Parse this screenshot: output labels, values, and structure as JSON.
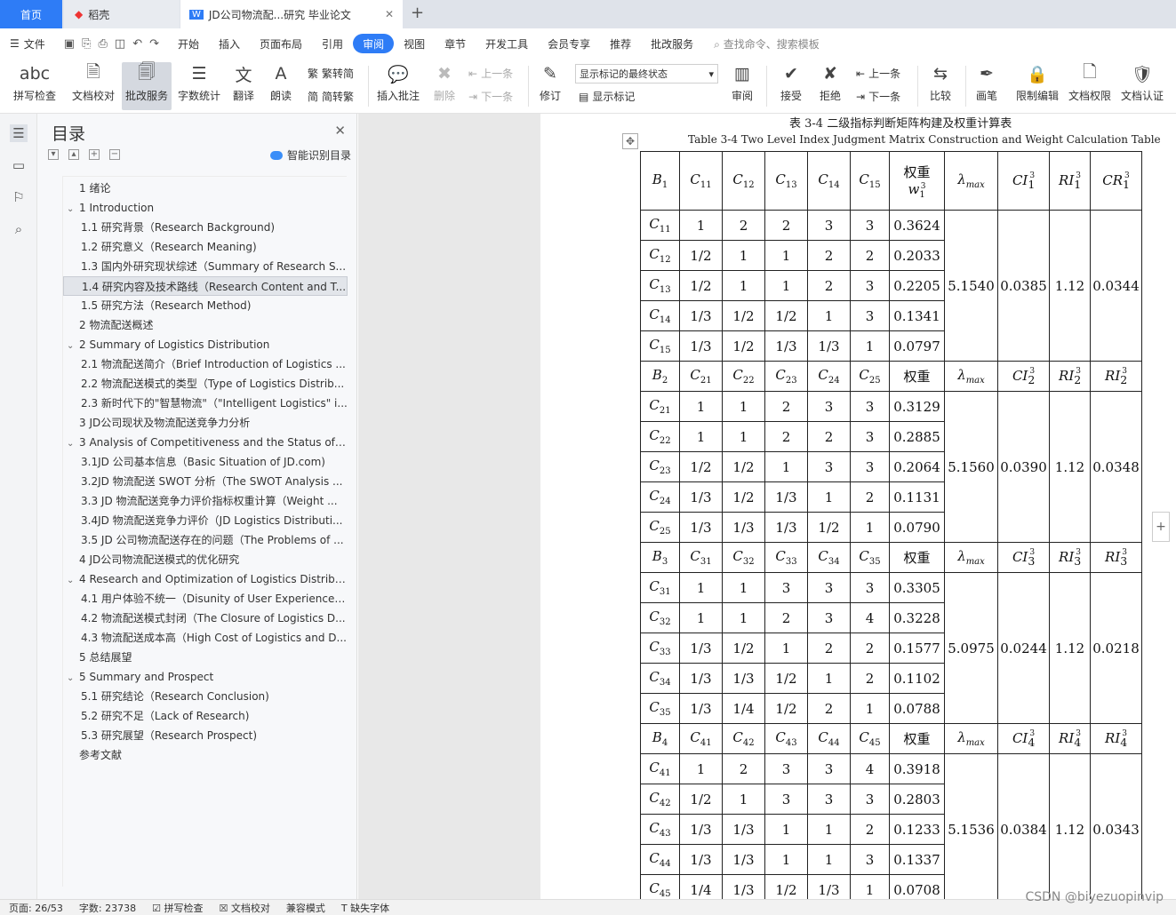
{
  "tabs": {
    "home": "首页",
    "daoke": "稻壳",
    "doc": "JD公司物流配...研究 毕业论文"
  },
  "menu": {
    "file": "文件",
    "items": [
      "开始",
      "插入",
      "页面布局",
      "引用",
      "审阅",
      "视图",
      "章节",
      "开发工具",
      "会员专享",
      "推荐",
      "批改服务"
    ],
    "active": "审阅",
    "search": "查找命令、搜索模板"
  },
  "ribbon": {
    "spell": "拼写检查",
    "proof": "文档校对",
    "grading": "批改服务",
    "wordcount": "字数统计",
    "translate": "翻译",
    "read": "朗读",
    "trad": "繁转简",
    "simp": "简转繁",
    "add_comment": "插入批注",
    "delete": "删除",
    "prev": "上一条",
    "next": "下一条",
    "track": "修订",
    "markup_state": "显示标记的最终状态",
    "show_markup": "显示标记",
    "review": "审阅",
    "accept": "接受",
    "reject": "拒绝",
    "prev2": "上一条",
    "next2": "下一条",
    "compare": "比较",
    "pen": "画笔",
    "restrict": "限制编辑",
    "perm": "文档权限",
    "cert": "文档认证"
  },
  "toc": {
    "title": "目录",
    "smart": "智能识别目录",
    "items": [
      {
        "level": 1,
        "text": "1  绪论",
        "chev": ""
      },
      {
        "level": 1,
        "text": "1 Introduction",
        "chev": "v"
      },
      {
        "level": 2,
        "text": "1.1  研究背景（Research Background)"
      },
      {
        "level": 2,
        "text": "1.2  研究意义（Research Meaning)"
      },
      {
        "level": 2,
        "text": "1.3  国内外研究现状综述（Summary of Research S..."
      },
      {
        "level": 2,
        "text": "1.4 研究内容及技术路线（Research Content and T...",
        "selected": true
      },
      {
        "level": 2,
        "text": "1.5 研究方法（Research Method)"
      },
      {
        "level": 1,
        "text": "2  物流配送概述",
        "chev": ""
      },
      {
        "level": 1,
        "text": "2 Summary of Logistics Distribution",
        "chev": "v"
      },
      {
        "level": 2,
        "text": "2.1 物流配送简介（Brief Introduction of Logistics ..."
      },
      {
        "level": 2,
        "text": "2.2 物流配送模式的类型（Type of Logistics Distrib..."
      },
      {
        "level": 2,
        "text": "2.3 新时代下的\"智慧物流\"（\"Intelligent Logistics\" i..."
      },
      {
        "level": 1,
        "text": "3 JD公司现状及物流配送竞争力分析",
        "chev": ""
      },
      {
        "level": 1,
        "text": "3 Analysis of Competitiveness and the Status of JD...",
        "chev": "v"
      },
      {
        "level": 2,
        "text": "3.1JD 公司基本信息（Basic Situation of JD.com)"
      },
      {
        "level": 2,
        "text": "3.2JD 物流配送 SWOT 分析（The SWOT Analysis ..."
      },
      {
        "level": 2,
        "text": "3.3 JD 物流配送竞争力评价指标权重计算（Weight ..."
      },
      {
        "level": 2,
        "text": "3.4JD 物流配送竞争力评价（JD Logistics Distributi..."
      },
      {
        "level": 2,
        "text": "3.5 JD 公司物流配送存在的问题（The Problems of ..."
      },
      {
        "level": 1,
        "text": "4 JD公司物流配送模式的优化研究",
        "chev": ""
      },
      {
        "level": 1,
        "text": "4 Research and Optimization of Logistics Distributi...",
        "chev": "v"
      },
      {
        "level": 2,
        "text": "4.1 用户体验不统一（Disunity of User Experience ..."
      },
      {
        "level": 2,
        "text": "4.2 物流配送模式封闭（The Closure of Logistics D..."
      },
      {
        "level": 2,
        "text": "4.3 物流配送成本高（High Cost of Logistics and D..."
      },
      {
        "level": 1,
        "text": "5  总结展望",
        "chev": ""
      },
      {
        "level": 1,
        "text": "5 Summary and Prospect",
        "chev": "v"
      },
      {
        "level": 2,
        "text": "5.1 研究结论（Research Conclusion)"
      },
      {
        "level": 2,
        "text": "5.2 研究不足（Lack of Research)"
      },
      {
        "level": 2,
        "text": "5.3 研究展望（Research Prospect)"
      },
      {
        "level": 0,
        "text": "参考文献",
        "chev": ""
      }
    ]
  },
  "document": {
    "caption_cn": "表  3-4  二级指标判断矩阵构建及权重计算表",
    "caption_en": "Table 3-4 Two Level Index Judgment Matrix Construction and Weight Calculation Table",
    "header0": [
      "B1",
      "C11",
      "C12",
      "C13",
      "C14",
      "C15",
      "权重 w13",
      "λmax",
      "CI13",
      "RI13",
      "CR13"
    ],
    "blocks": [
      {
        "header": null,
        "rows": [
          [
            "C11",
            "1",
            "2",
            "2",
            "3",
            "3",
            "0.3624"
          ],
          [
            "C12",
            "1/2",
            "1",
            "1",
            "2",
            "2",
            "0.2033"
          ],
          [
            "C13",
            "1/2",
            "1",
            "1",
            "2",
            "3",
            "0.2205"
          ],
          [
            "C14",
            "1/3",
            "1/2",
            "1/2",
            "1",
            "3",
            "0.1341"
          ],
          [
            "C15",
            "1/3",
            "1/2",
            "1/3",
            "1/3",
            "1",
            "0.0797"
          ]
        ],
        "lmax": "5.1540",
        "ci": "0.0385",
        "ri": "1.12",
        "cr": "0.0344"
      },
      {
        "header": [
          "B2",
          "C21",
          "C22",
          "C23",
          "C24",
          "C25",
          "权重",
          "λmax",
          "CI23",
          "RI23",
          "RI23"
        ],
        "rows": [
          [
            "C21",
            "1",
            "1",
            "2",
            "3",
            "3",
            "0.3129"
          ],
          [
            "C22",
            "1",
            "1",
            "2",
            "2",
            "3",
            "0.2885"
          ],
          [
            "C23",
            "1/2",
            "1/2",
            "1",
            "3",
            "3",
            "0.2064"
          ],
          [
            "C24",
            "1/3",
            "1/2",
            "1/3",
            "1",
            "2",
            "0.1131"
          ],
          [
            "C25",
            "1/3",
            "1/3",
            "1/3",
            "1/2",
            "1",
            "0.0790"
          ]
        ],
        "lmax": "5.1560",
        "ci": "0.0390",
        "ri": "1.12",
        "cr": "0.0348"
      },
      {
        "header": [
          "B3",
          "C31",
          "C32",
          "C33",
          "C34",
          "C35",
          "权重",
          "λmax",
          "CI33",
          "RI33",
          "RI33"
        ],
        "rows": [
          [
            "C31",
            "1",
            "1",
            "3",
            "3",
            "3",
            "0.3305"
          ],
          [
            "C32",
            "1",
            "1",
            "2",
            "3",
            "4",
            "0.3228"
          ],
          [
            "C33",
            "1/3",
            "1/2",
            "1",
            "2",
            "2",
            "0.1577"
          ],
          [
            "C34",
            "1/3",
            "1/3",
            "1/2",
            "1",
            "2",
            "0.1102"
          ],
          [
            "C35",
            "1/3",
            "1/4",
            "1/2",
            "2",
            "1",
            "0.0788"
          ]
        ],
        "lmax": "5.0975",
        "ci": "0.0244",
        "ri": "1.12",
        "cr": "0.0218"
      },
      {
        "header": [
          "B4",
          "C41",
          "C42",
          "C43",
          "C44",
          "C45",
          "权重",
          "λmax",
          "CI43",
          "RI43",
          "RI43"
        ],
        "rows": [
          [
            "C41",
            "1",
            "2",
            "3",
            "3",
            "4",
            "0.3918"
          ],
          [
            "C42",
            "1/2",
            "1",
            "3",
            "3",
            "3",
            "0.2803"
          ],
          [
            "C43",
            "1/3",
            "1/3",
            "1",
            "1",
            "2",
            "0.1233"
          ],
          [
            "C44",
            "1/3",
            "1/3",
            "1",
            "1",
            "3",
            "0.1337"
          ],
          [
            "C45",
            "1/4",
            "1/3",
            "1/2",
            "1/3",
            "1",
            "0.0708"
          ]
        ],
        "lmax": "5.1536",
        "ci": "0.0384",
        "ri": "1.12",
        "cr": "0.0343"
      }
    ]
  },
  "status": {
    "page": "页面: 26/53",
    "words": "字数: 23738",
    "spell": "拼写检查",
    "proof": "文档校对",
    "compat": "兼容模式",
    "font": "缺失字体"
  },
  "watermark": "CSDN @biyezuopinvip",
  "colors": {
    "accent": "#2e7cf6"
  }
}
